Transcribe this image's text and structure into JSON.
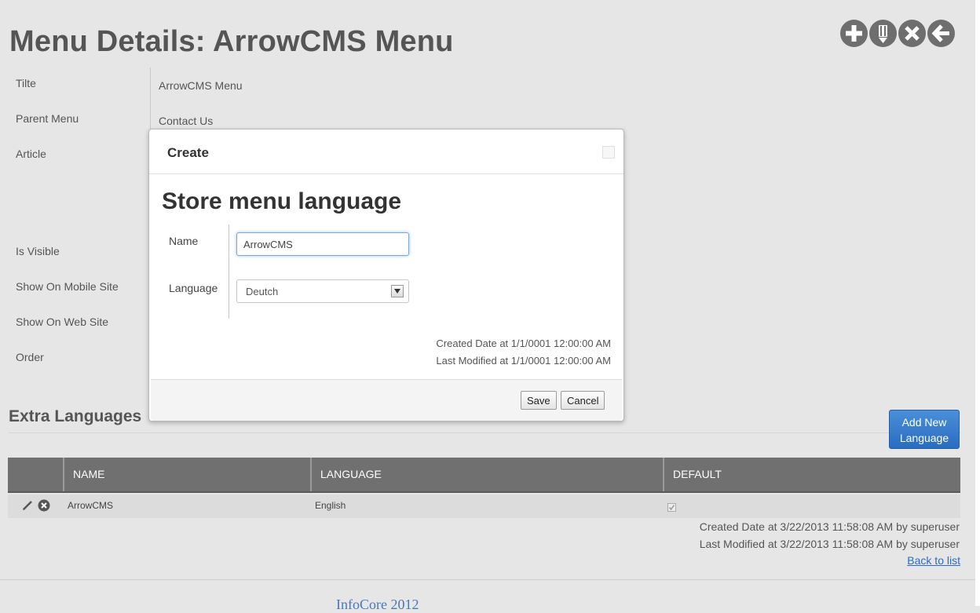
{
  "page": {
    "title": "Menu Details: ArrowCMS Menu"
  },
  "toolbar": {
    "icons": [
      "plus-icon",
      "edit-icon",
      "close-icon",
      "back-arrow-icon"
    ],
    "icon_color": "#6e6e6e"
  },
  "details": {
    "labels": {
      "title": "Tilte",
      "parent_menu": "Parent Menu",
      "article": "Article",
      "is_visible": "Is Visible",
      "show_mobile": "Show On Mobile Site",
      "show_web": "Show On Web Site",
      "order": "Order"
    },
    "values": {
      "title": "ArrowCMS Menu",
      "parent_menu": "Contact Us"
    }
  },
  "extra_languages": {
    "title": "Extra Languages",
    "add_button": "Add New Language",
    "add_button_color": "#2f74c8",
    "columns": {
      "name": "NAME",
      "language": "LANGUAGE",
      "default": "DEFAULT"
    },
    "rows": [
      {
        "name": "ArrowCMS",
        "language": "English",
        "default": true
      }
    ],
    "created": "Created Date at 3/22/2013 11:58:08 AM by superuser",
    "modified": "Last Modified at 3/22/2013 11:58:08 AM by superuser",
    "back_link": "Back to list"
  },
  "footer": {
    "text": "InfoCore 2012"
  },
  "modal": {
    "title": "Create",
    "heading": "Store menu language",
    "name_label": "Name",
    "name_value": "ArrowCMS",
    "language_label": "Language",
    "language_value": "Deutch",
    "created": "Created Date at 1/1/0001 12:00:00 AM",
    "modified": "Last Modified at 1/1/0001 12:00:00 AM",
    "save_label": "Save",
    "cancel_label": "Cancel"
  }
}
